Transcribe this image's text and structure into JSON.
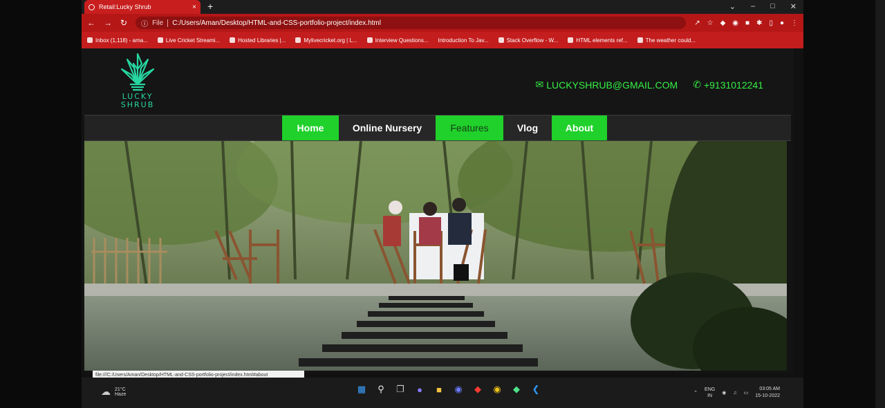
{
  "browser": {
    "tab_title": "Retail:Lucky Shrub",
    "tab_close": "×",
    "new_tab": "+",
    "address_prefix": "File",
    "address": "C:/Users/Aman/Desktop/HTML-and-CSS-portfolio-project/index.html",
    "bookmarks": [
      "Inbox (1,118) - ama...",
      "Live Cricket Streami...",
      "Hosted Libraries |...",
      "Mylivecricket.org | L...",
      "Interview Questions...",
      "Introduction To Jav...",
      "Stack Overflow - W...",
      "HTML elements ref...",
      "The weather could..."
    ],
    "status_url": "file:///C:/Users/Aman/Desktop/HTML-and-CSS-portfolio-project/index.html#about"
  },
  "site": {
    "logo_line1": "LUCKY",
    "logo_line2": "SHRUB",
    "email": "LUCKYSHRUB@GMAIL.COM",
    "phone": "+9131012241",
    "nav": [
      {
        "label": "Home",
        "style": "green"
      },
      {
        "label": "Online Nursery",
        "style": "dark"
      },
      {
        "label": "Features",
        "style": "green"
      },
      {
        "label": "Vlog",
        "style": "dark"
      },
      {
        "label": "About",
        "style": "green"
      }
    ]
  },
  "taskbar": {
    "weather_temp": "21°C",
    "weather_desc": "Haze",
    "lang_line1": "ENG",
    "lang_line2": "IN",
    "time": "03:05 AM",
    "date": "15-10-2022"
  },
  "colors": {
    "accent_green": "#1fd12a",
    "contact_green": "#35f046",
    "browser_red": "#b51717"
  }
}
